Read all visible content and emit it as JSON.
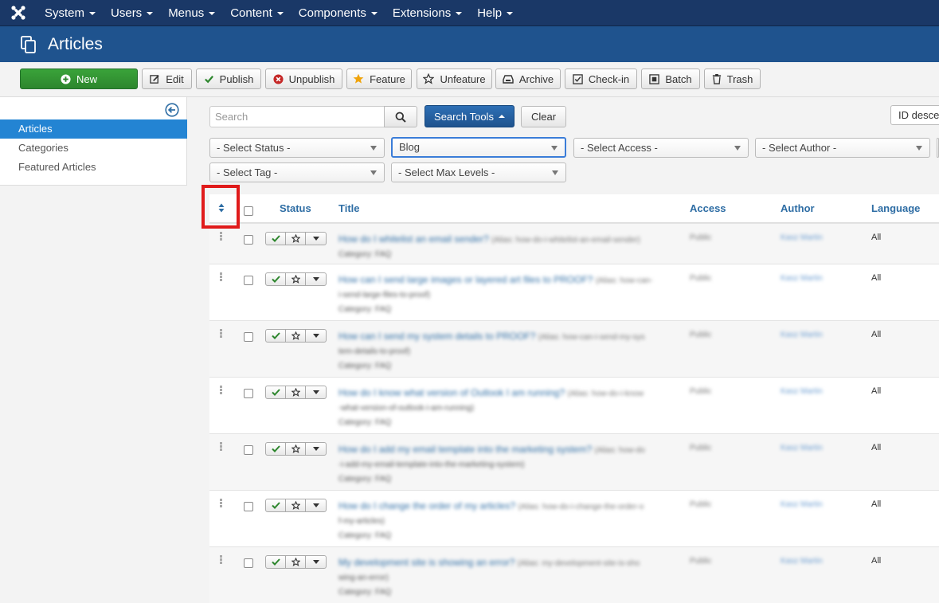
{
  "nav": {
    "menus": [
      "System",
      "Users",
      "Menus",
      "Content",
      "Components",
      "Extensions",
      "Help"
    ]
  },
  "header": {
    "title": "Articles"
  },
  "toolbar": {
    "new": "New",
    "edit": "Edit",
    "publish": "Publish",
    "unpublish": "Unpublish",
    "feature": "Feature",
    "unfeature": "Unfeature",
    "archive": "Archive",
    "checkin": "Check-in",
    "batch": "Batch",
    "trash": "Trash"
  },
  "sidebar": {
    "items": [
      "Articles",
      "Categories",
      "Featured Articles"
    ],
    "active": "Articles"
  },
  "filters": {
    "search_placeholder": "Search",
    "search_tools": "Search Tools",
    "clear": "Clear",
    "ordering": "ID desce",
    "status": "- Select Status -",
    "category": "Blog",
    "access": "- Select Access -",
    "author": "- Select Author -",
    "tag": "- Select Tag -",
    "max_levels": "- Select Max Levels -"
  },
  "table": {
    "columns": {
      "status": "Status",
      "title": "Title",
      "access": "Access",
      "author": "Author",
      "language": "Language"
    },
    "rows": [
      {
        "title": "How do I whitelist an email sender?",
        "alias": "(Alias: how-do-i-whitelist-an-email-sender)",
        "alias2": "",
        "category": "Category: FAQ",
        "access": "Public",
        "author": "Kasz Martin",
        "language": "All"
      },
      {
        "title": "How can I send large images or layered art files to PROOF?",
        "alias": "(Alias: how-can-",
        "alias2": "i-send-large-files-to-proof)",
        "category": "Category: FAQ",
        "access": "Public",
        "author": "Kasz Martin",
        "language": "All"
      },
      {
        "title": "How can I send my system details to PROOF?",
        "alias": "(Alias: how-can-i-send-my-sys",
        "alias2": "tem-details-to-proof)",
        "category": "Category: FAQ",
        "access": "Public",
        "author": "Kasz Martin",
        "language": "All"
      },
      {
        "title": "How do I know what version of Outlook I am running?",
        "alias": "(Alias: how-do-i-know",
        "alias2": "-what-version-of-outlook-i-am-running)",
        "category": "Category: FAQ",
        "access": "Public",
        "author": "Kasz Martin",
        "language": "All"
      },
      {
        "title": "How do I add my email template into the marketing system?",
        "alias": "(Alias: how-do",
        "alias2": "-i-add-my-email-template-into-the-marketing-system)",
        "category": "Category: FAQ",
        "access": "Public",
        "author": "Kasz Martin",
        "language": "All"
      },
      {
        "title": "How do I change the order of my articles?",
        "alias": "(Alias: how-do-i-change-the-order-o",
        "alias2": "f-my-articles)",
        "category": "Category: FAQ",
        "access": "Public",
        "author": "Kasz Martin",
        "language": "All"
      },
      {
        "title": "My development site is showing an error?",
        "alias": "(Alias: my-development-site-is-sho",
        "alias2": "wing-an-error)",
        "category": "Category: FAQ",
        "access": "Public",
        "author": "Kasz Martin",
        "language": "All"
      }
    ]
  },
  "colors": {
    "nav_bg": "#1a3867",
    "header_bg": "#1f538e",
    "accent": "#2384d3",
    "new_button": "#2d862d",
    "highlight": "#e01b1b"
  }
}
